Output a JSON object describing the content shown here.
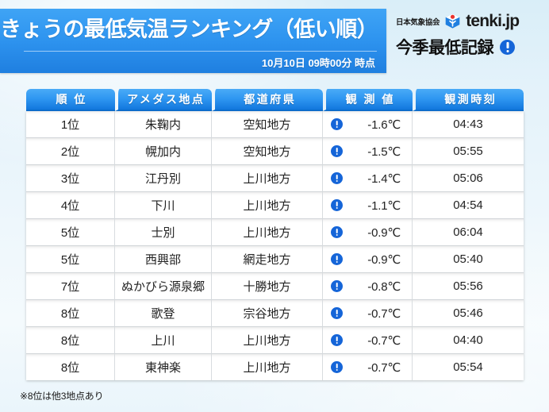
{
  "header": {
    "title": "きょうの最低気温ランキング（低い順）",
    "timestamp": "10月10日  09時00分 時点",
    "association": "日本気象協会",
    "wordmark": "tenki.jp",
    "logo_icon": "tenki-cube-sun-icon",
    "record_label": "今季最低記録",
    "record_icon": "exclamation-badge-icon",
    "panel_color": "#2f95f0",
    "title_text_color": "#ffffff"
  },
  "table": {
    "columns": [
      {
        "key": "rank",
        "label": "順 位"
      },
      {
        "key": "station",
        "label": "アメダス地点"
      },
      {
        "key": "prefecture",
        "label": "都道府県"
      },
      {
        "key": "observed_value",
        "label": "観 測 値"
      },
      {
        "key": "observed_time",
        "label": "観測時刻"
      }
    ],
    "header_bg_color": "#2e96f1",
    "row_bg_color": "#ffffff",
    "rows": [
      {
        "rank": "1位",
        "station": "朱鞠内",
        "prefecture": "空知地方",
        "icon": "exclamation-badge-icon",
        "observed_value": "-1.6℃",
        "observed_time": "04:43"
      },
      {
        "rank": "2位",
        "station": "幌加内",
        "prefecture": "空知地方",
        "icon": "exclamation-badge-icon",
        "observed_value": "-1.5℃",
        "observed_time": "05:55"
      },
      {
        "rank": "3位",
        "station": "江丹別",
        "prefecture": "上川地方",
        "icon": "exclamation-badge-icon",
        "observed_value": "-1.4℃",
        "observed_time": "05:06"
      },
      {
        "rank": "4位",
        "station": "下川",
        "prefecture": "上川地方",
        "icon": "exclamation-badge-icon",
        "observed_value": "-1.1℃",
        "observed_time": "04:54"
      },
      {
        "rank": "5位",
        "station": "士別",
        "prefecture": "上川地方",
        "icon": "exclamation-badge-icon",
        "observed_value": "-0.9℃",
        "observed_time": "06:04"
      },
      {
        "rank": "5位",
        "station": "西興部",
        "prefecture": "網走地方",
        "icon": "exclamation-badge-icon",
        "observed_value": "-0.9℃",
        "observed_time": "05:40"
      },
      {
        "rank": "7位",
        "station": "ぬかびら源泉郷",
        "prefecture": "十勝地方",
        "icon": "exclamation-badge-icon",
        "observed_value": "-0.8℃",
        "observed_time": "05:56"
      },
      {
        "rank": "8位",
        "station": "歌登",
        "prefecture": "宗谷地方",
        "icon": "exclamation-badge-icon",
        "observed_value": "-0.7℃",
        "observed_time": "05:46"
      },
      {
        "rank": "8位",
        "station": "上川",
        "prefecture": "上川地方",
        "icon": "exclamation-badge-icon",
        "observed_value": "-0.7℃",
        "observed_time": "04:40"
      },
      {
        "rank": "8位",
        "station": "東神楽",
        "prefecture": "上川地方",
        "icon": "exclamation-badge-icon",
        "observed_value": "-0.7℃",
        "observed_time": "05:54"
      }
    ]
  },
  "footnote": "※8位は他3地点あり"
}
